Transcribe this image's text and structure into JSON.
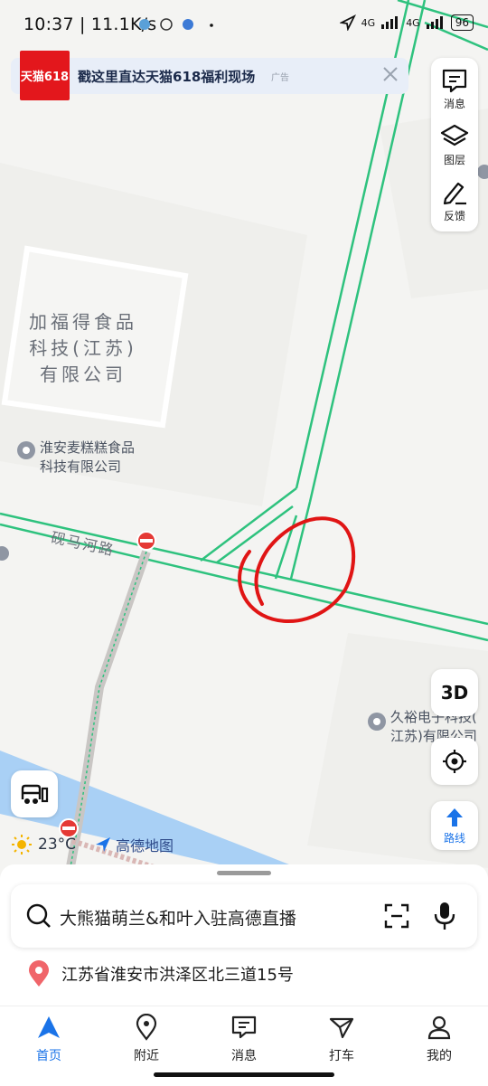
{
  "status_bar": {
    "time": "10:37",
    "net_speed": "11.1K/s",
    "sig1": "4G",
    "sig2": "4G",
    "battery": "96"
  },
  "banner": {
    "logo_text": "天猫618",
    "text": "戳这里直达天猫618福利现场",
    "ad_tag": "广告"
  },
  "tools": {
    "messages": "消息",
    "layers": "图层",
    "feedback": "反馈"
  },
  "map": {
    "building_label_1": "加福得食品",
    "building_label_2": "科技(江苏)",
    "building_label_3": "有限公司",
    "poi_1_line1": "淮安麦糕糕食品",
    "poi_1_line2": "科技有限公司",
    "road_name": "砚马河路",
    "poi_2_line1": "久裕电子科技(",
    "poi_2_line2": "江苏)有限公司",
    "colors": {
      "road_green": "#2ec27e",
      "river": "#a9d0f5",
      "annotation": "#e01515"
    }
  },
  "controls": {
    "btn_3d": "3D",
    "route": "路线"
  },
  "weather": {
    "temp": "23°C",
    "brand": "高德地图"
  },
  "search": {
    "placeholder": "大熊猫萌兰&和叶入驻高德直播"
  },
  "location": {
    "address": "江苏省淮安市洪泽区北三道15号"
  },
  "tabs": [
    {
      "label": "首页"
    },
    {
      "label": "附近"
    },
    {
      "label": "消息"
    },
    {
      "label": "打车"
    },
    {
      "label": "我的"
    }
  ]
}
